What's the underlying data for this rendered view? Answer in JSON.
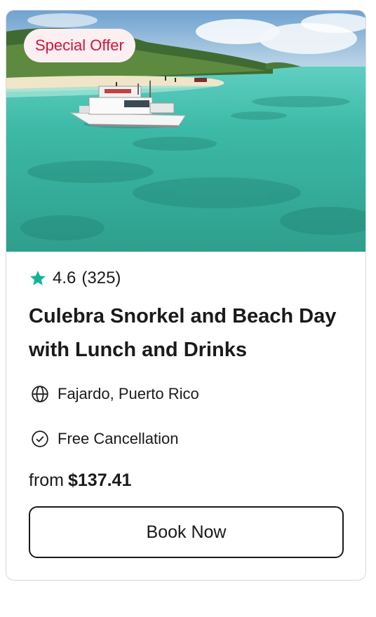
{
  "card": {
    "badge": "Special Offer",
    "rating": {
      "score": "4.6",
      "count": "(325)"
    },
    "title": "Culebra Snorkel and Beach Day with Lunch and Drinks",
    "location": "Fajardo, Puerto Rico",
    "cancellation": "Free Cancellation",
    "price": {
      "prefix": "from",
      "amount": "$137.41"
    },
    "book_label": "Book Now"
  },
  "colors": {
    "badge_text": "#d4143d",
    "badge_bg": "#fbeff1",
    "star": "#12b59a",
    "text": "#1a1a1a"
  },
  "icons": [
    "star-icon",
    "globe-icon",
    "check-circle-icon"
  ]
}
